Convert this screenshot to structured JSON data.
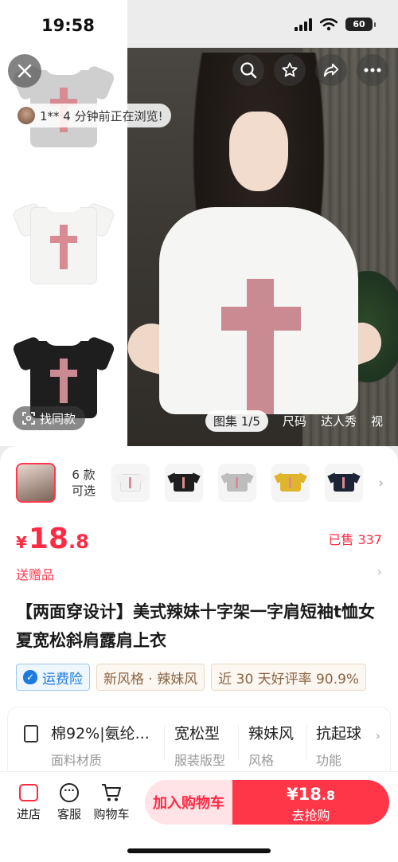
{
  "status_bar": {
    "time": "19:58",
    "battery": "60"
  },
  "hero": {
    "browse_tip": "1** 4 分钟前正在浏览!",
    "find_same": "找同款",
    "media_tabs": [
      "图集 1/5",
      "尺码",
      "达人秀",
      "视"
    ]
  },
  "sku": {
    "count_line1": "6 款",
    "count_line2": "可选",
    "thumbs": [
      {
        "color": "#f1f1f1"
      },
      {
        "color": "#1e1e1e"
      },
      {
        "color": "#bdbdbd"
      },
      {
        "color": "#e0b52c"
      },
      {
        "color": "#1c2436"
      }
    ]
  },
  "price": {
    "currency": "¥",
    "integer": "18",
    "decimal": ".8",
    "sold": "已售 337"
  },
  "gift": "送赠品",
  "title": "【两面穿设计】美式辣妹十字架一字肩短袖t恤女夏宽松斜肩露肩上衣",
  "tags": [
    "运费险",
    "新风格 · 辣妹风",
    "近 30 天好评率 90.9%"
  ],
  "attributes": [
    {
      "value": "棉92%|氨纶...",
      "label": "面料材质"
    },
    {
      "value": "宽松型",
      "label": "服装版型"
    },
    {
      "value": "辣妹风",
      "label": "风格"
    },
    {
      "value": "抗起球",
      "label": "功能"
    }
  ],
  "bottom": {
    "store": "进店",
    "service": "客服",
    "cart": "购物车",
    "add_cart": "加入购物车",
    "buy_price_int": "¥18",
    "buy_price_dec": ".8",
    "buy_label": "去抢购"
  }
}
